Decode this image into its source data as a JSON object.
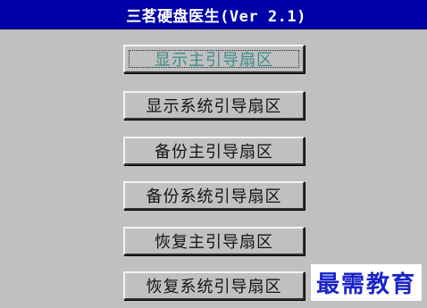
{
  "window": {
    "title": "三茗硬盘医生(Ver 2.1)"
  },
  "menu": {
    "items": [
      {
        "label": "显示主引导扇区",
        "selected": true
      },
      {
        "label": "显示系统引导扇区",
        "selected": false
      },
      {
        "label": "备份主引导扇区",
        "selected": false
      },
      {
        "label": "备份系统引导扇区",
        "selected": false
      },
      {
        "label": "恢复主引导扇区",
        "selected": false
      },
      {
        "label": "恢复系统引导扇区",
        "selected": false
      }
    ]
  },
  "watermark": {
    "text": "最需教育"
  },
  "colors": {
    "titlebar_background": "#0000a8",
    "window_background": "#c0c0c0",
    "selected_label": "#3c8c8c",
    "watermark_text": "#1a23c8"
  }
}
